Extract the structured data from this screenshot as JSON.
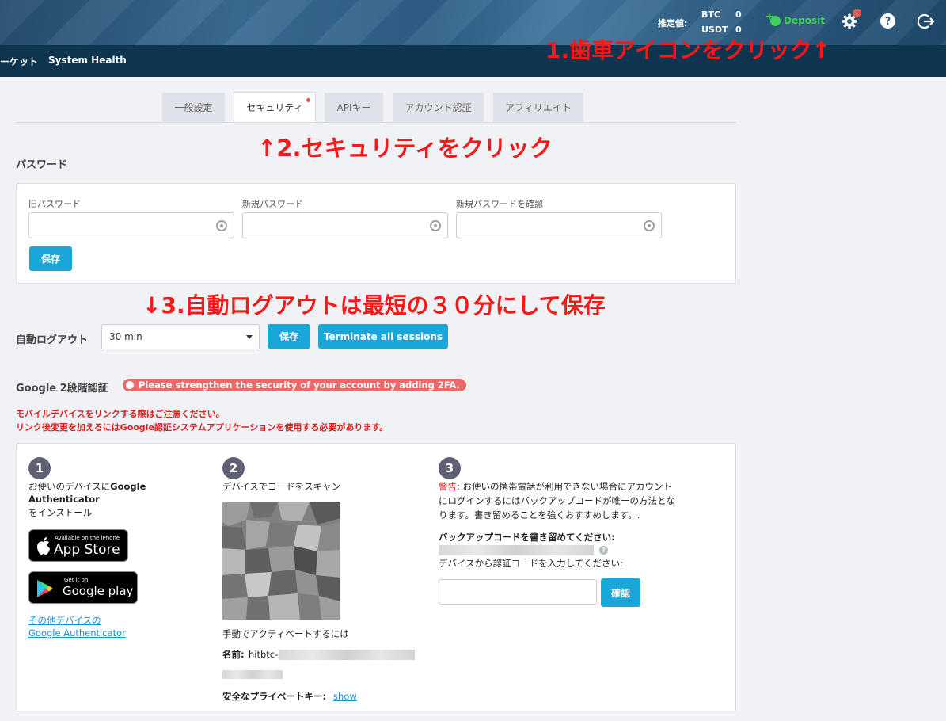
{
  "header": {
    "nav_partial": "ーケット",
    "nav_system_health": "System Health",
    "estimate_label": "推定値:",
    "btc_label": "BTC",
    "btc_value": "0",
    "usdt_label": "USDT",
    "usdt_value": "0",
    "deposit_label": "Deposit",
    "settings_badge": "!"
  },
  "annotations": {
    "step1": "1.歯車アイコンをクリック↑",
    "step2": "↑2.セキュリティをクリック",
    "step3": "↓3.自動ログアウトは最短の３０分にして保存"
  },
  "tabs": [
    {
      "label": "一般設定"
    },
    {
      "label": "セキュリティ"
    },
    {
      "label": "APIキー"
    },
    {
      "label": "アカウント認証"
    },
    {
      "label": "アフィリエイト"
    }
  ],
  "password": {
    "title": "パスワード",
    "old_label": "旧パスワード",
    "new_label": "新規パスワード",
    "confirm_label": "新規パスワードを確認",
    "save_label": "保存"
  },
  "autologout": {
    "label": "自動ログアウト",
    "selected": "30 min",
    "save_label": "保存",
    "terminate_label": "Terminate all sessions"
  },
  "twofa": {
    "title": "Google 2段階認証",
    "alert": "Please strengthen the security of your account by adding 2FA.",
    "warning1": "モバイルデバイスをリンクする際はご注意ください。",
    "warning2": "リンク後変更を加えるにはGoogle認証システムアプリケーションを使用する必要があります。",
    "step1": {
      "num": "1",
      "line1_prefix": "お使いのデバイスに",
      "line1_bold": "Google",
      "line2": "Authenticator",
      "line3": "をインストール",
      "appstore_small": "Available on the iPhone",
      "appstore_big": "App Store",
      "googleplay_small": "Get it on",
      "googleplay_big": "Google play",
      "other_link1": "その他デバイスの",
      "other_link2": "Google Authenticator"
    },
    "step2": {
      "num": "2",
      "scan": "デバイスでコードをスキャン",
      "manual": "手動でアクティベートするには",
      "name_label": "名前:",
      "name_value": "hitbtc-",
      "key_label": "安全なプライベートキー:",
      "show_link": "show"
    },
    "step3": {
      "num": "3",
      "warn_word": "警告",
      "warn_rest": ": お使いの携帯電話が利用できない場合にアカウント",
      "warn_line2": "にログインするにはバックアップコードが唯一の方法とな",
      "warn_line3": "ります。書き留めることを強くおすすめします。.",
      "backup_label": "バックアップコードを書き留めてください:",
      "help_icon": "?",
      "enter_code": "デバイスから認証コードを入力してください:",
      "confirm_label": "確認"
    }
  }
}
